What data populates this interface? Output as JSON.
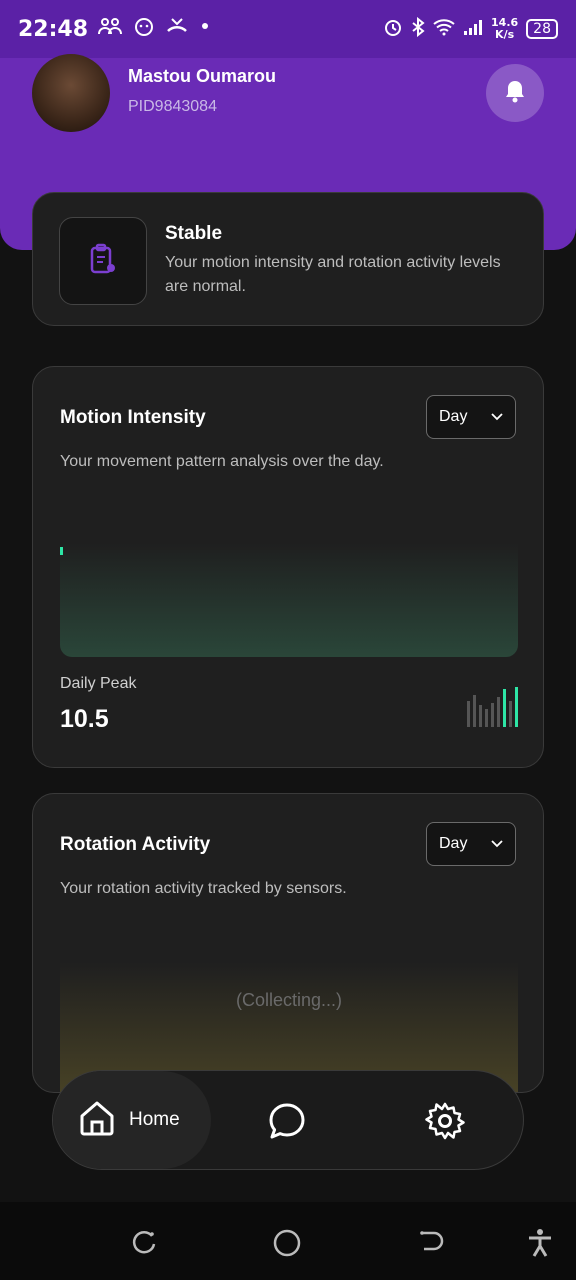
{
  "status_bar": {
    "time": "22:48",
    "speed_value": "14.6",
    "speed_unit": "K/s",
    "battery": "28"
  },
  "user": {
    "name": "Mastou Oumarou",
    "pid": "PID9843084"
  },
  "status_card": {
    "title": "Stable",
    "description": "Your motion intensity and rotation activity levels are normal."
  },
  "motion_card": {
    "title": "Motion Intensity",
    "subtitle": "Your movement pattern analysis over the day.",
    "period": "Day",
    "peak_label": "Daily Peak",
    "peak_value": "10.5",
    "accent": "#2ee6a6"
  },
  "rotation_card": {
    "title": "Rotation Activity",
    "subtitle": "Your rotation activity tracked by sensors.",
    "period": "Day",
    "placeholder": "(Collecting...)"
  },
  "nav": {
    "home_label": "Home",
    "items": [
      "home-icon",
      "chat-icon",
      "settings-icon"
    ]
  },
  "colors": {
    "header": "#6a2bb6",
    "status_bar": "#5b21a6",
    "background": "#121212"
  }
}
